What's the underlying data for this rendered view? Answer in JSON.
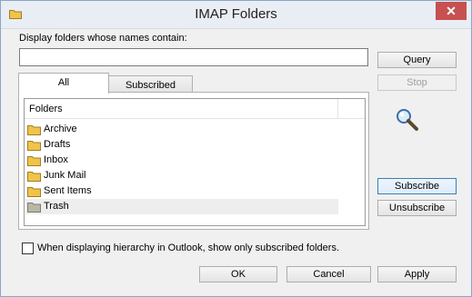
{
  "window": {
    "title": "IMAP Folders",
    "close_glyph": "✕",
    "title_icon": "folder-icon"
  },
  "filter": {
    "label": "Display folders whose names contain:",
    "value": "",
    "placeholder": ""
  },
  "buttons": {
    "query": "Query",
    "stop": "Stop",
    "subscribe": "Subscribe",
    "unsubscribe": "Unsubscribe",
    "ok": "OK",
    "cancel": "Cancel",
    "apply": "Apply"
  },
  "tabs": [
    {
      "label": "All",
      "active": true
    },
    {
      "label": "Subscribed",
      "active": false
    }
  ],
  "list": {
    "column_header": "Folders",
    "items": [
      {
        "label": "Archive",
        "icon": "folder-icon"
      },
      {
        "label": "Drafts",
        "icon": "folder-icon"
      },
      {
        "label": "Inbox",
        "icon": "folder-icon"
      },
      {
        "label": "Junk Mail",
        "icon": "folder-icon"
      },
      {
        "label": "Sent Items",
        "icon": "folder-icon"
      },
      {
        "label": "Trash",
        "icon": "folder-gray-icon",
        "selected": true
      }
    ]
  },
  "status_icon": "magnifier-icon",
  "subscribed_only": {
    "label": "When displaying hierarchy in Outlook, show only subscribed folders.",
    "checked": false
  },
  "colors": {
    "folder_yellow": "#f0c44a",
    "folder_gray": "#b9b7a6",
    "close_red": "#c75050"
  }
}
